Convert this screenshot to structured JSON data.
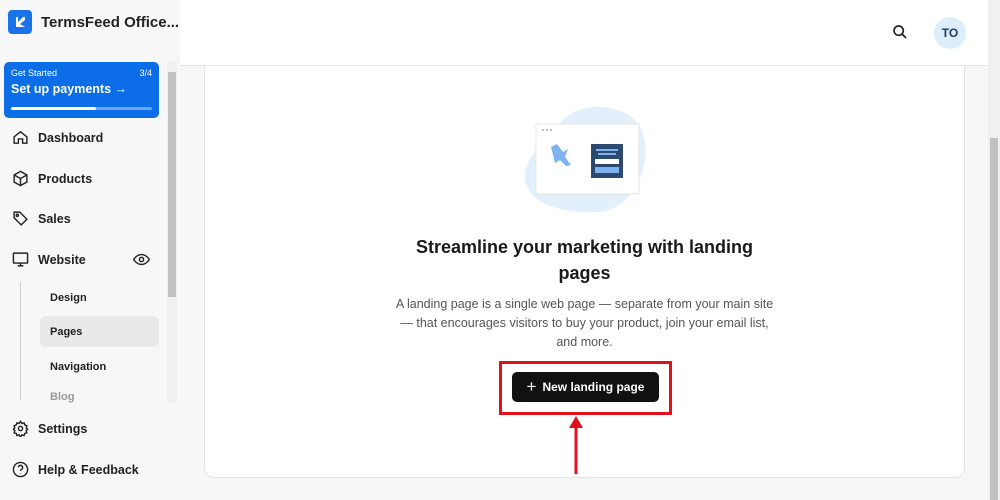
{
  "sidebar": {
    "brand": "TermsFeed Office...",
    "promo": {
      "label": "Get Started",
      "step": "3/4",
      "title": "Set up payments",
      "progress_percent": 60
    },
    "items": [
      {
        "label": "Dashboard",
        "icon": "home-icon"
      },
      {
        "label": "Products",
        "icon": "box-icon"
      },
      {
        "label": "Sales",
        "icon": "tag-icon"
      },
      {
        "label": "Website",
        "icon": "monitor-icon"
      }
    ],
    "website_sub": [
      "Design",
      "Pages",
      "Navigation",
      "Blog"
    ],
    "active_sub": "Pages",
    "bottom": [
      {
        "label": "Settings",
        "icon": "gear-icon"
      },
      {
        "label": "Help & Feedback",
        "icon": "help-icon"
      }
    ]
  },
  "header": {
    "avatar": "TO"
  },
  "main": {
    "headline": "Streamline your marketing with landing pages",
    "description": "A landing page is a single web page — separate from your main site — that encourages visitors to buy your product, join your email list, and more.",
    "cta": "New landing page"
  },
  "colors": {
    "accent": "#0b6ee8",
    "highlight": "#e0111b"
  }
}
